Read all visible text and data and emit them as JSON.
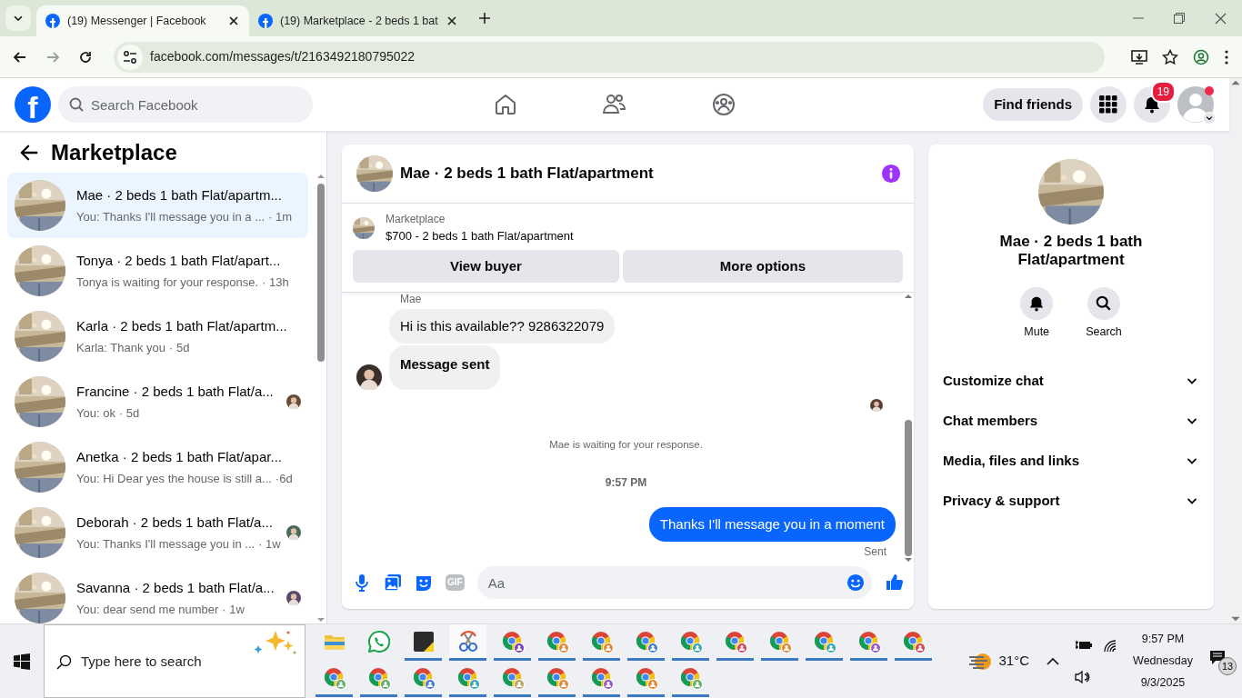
{
  "browser": {
    "tabs": [
      {
        "title": "(19) Messenger | Facebook",
        "selected": true
      },
      {
        "title": "(19) Marketplace - 2 beds 1 bat",
        "selected": false
      }
    ],
    "address": "facebook.com/messages/t/2163492180795022"
  },
  "facebook": {
    "logo": "f",
    "search_placeholder": "Search Facebook",
    "find_friends": "Find friends",
    "notification_count": "19",
    "profile_dot": true
  },
  "sidebar": {
    "title": "Marketplace",
    "conversations": [
      {
        "name": "Mae · 2 beds 1 bath Flat/apartm...",
        "preview": "You: Thanks I'll message you in a ...",
        "time": "· 1m",
        "selected": true,
        "seen": false
      },
      {
        "name": "Tonya · 2 beds 1 bath Flat/apart...",
        "preview": "Tonya is waiting for your response.",
        "time": "· 13h",
        "selected": false,
        "seen": false
      },
      {
        "name": "Karla · 2 beds 1 bath Flat/apartm...",
        "preview": "Karla: Thank you",
        "time": "· 5d",
        "selected": false,
        "seen": false
      },
      {
        "name": "Francine · 2 beds 1 bath Flat/a...",
        "preview": "You: ok",
        "time": "· 5d",
        "selected": false,
        "seen": true
      },
      {
        "name": "Anetka · 2 beds 1 bath Flat/apar...",
        "preview": "You: Hi Dear yes the house is still a...",
        "time": "·6d",
        "selected": false,
        "seen": false
      },
      {
        "name": "Deborah · 2 beds 1 bath Flat/a...",
        "preview": "You: Thanks I'll message you in ...",
        "time": "· 1w",
        "selected": false,
        "seen": true
      },
      {
        "name": "Savanna · 2 beds 1 bath Flat/a...",
        "preview": "You: dear send me number",
        "time": "· 1w",
        "selected": false,
        "seen": true
      }
    ]
  },
  "chat": {
    "title": "Mae · 2 beds 1 bath Flat/apartment",
    "listing_source": "Marketplace",
    "listing": "$700 - 2 beds 1 bath Flat/apartment",
    "actions": [
      "View buyer",
      "More options"
    ],
    "messages": [
      {
        "kind": "sender",
        "text": "Mae"
      },
      {
        "kind": "incoming",
        "text": "Hi is this available?? 9286322079",
        "bold": false,
        "avatar": false
      },
      {
        "kind": "incoming",
        "text": "Message sent",
        "bold": true,
        "avatar": true
      },
      {
        "kind": "read_receipt"
      },
      {
        "kind": "notice",
        "text": "Mae is waiting for your response."
      },
      {
        "kind": "timestamp",
        "text": "9:57 PM"
      },
      {
        "kind": "outgoing",
        "text": "Thanks I'll message you in a moment"
      },
      {
        "kind": "status",
        "text": "Sent"
      }
    ],
    "gif_label": "GIF",
    "composer_placeholder": "Aa"
  },
  "details": {
    "title": "Mae · 2 beds 1 bath Flat/apartment",
    "actions": [
      {
        "kind": "mute",
        "label": "Mute"
      },
      {
        "kind": "search",
        "label": "Search"
      }
    ],
    "sections": [
      {
        "label": "Customize chat",
        "expanded": false
      },
      {
        "label": "Chat members",
        "expanded": false
      },
      {
        "label": "Media, files and links",
        "expanded": false
      },
      {
        "label": "Privacy & support",
        "expanded": false
      }
    ]
  },
  "taskbar": {
    "search_placeholder": "Type here to search",
    "apps": [
      {
        "kind": "folder",
        "running": false,
        "selected": false
      },
      {
        "kind": "whatsapp",
        "running": false,
        "selected": false
      },
      {
        "kind": "notes",
        "running": true,
        "selected": false
      },
      {
        "kind": "snipping",
        "running": true,
        "selected": true
      },
      {
        "kind": "browser",
        "running": true,
        "selected": false,
        "color": "#7b3fb0"
      },
      {
        "kind": "browser",
        "running": true,
        "selected": false,
        "color": "#e0883a"
      },
      {
        "kind": "browser",
        "running": true,
        "selected": false,
        "color": "#e0883a"
      },
      {
        "kind": "browser",
        "running": true,
        "selected": false,
        "color": "#4a7fd0"
      },
      {
        "kind": "browser",
        "running": true,
        "selected": false,
        "color": "#3aa6b0"
      },
      {
        "kind": "browser",
        "running": true,
        "selected": false,
        "color": "#d9435a"
      },
      {
        "kind": "browser",
        "running": true,
        "selected": false,
        "color": "#e0883a"
      },
      {
        "kind": "browser",
        "running": true,
        "selected": false,
        "color": "#3aa6b0"
      },
      {
        "kind": "browser",
        "running": true,
        "selected": false,
        "color": "#9b59c6"
      },
      {
        "kind": "browser",
        "running": true,
        "selected": false,
        "color": "#d9435a"
      },
      {
        "kind": "browser",
        "running": true,
        "selected": false,
        "color": "#5fae6a"
      },
      {
        "kind": "browser",
        "running": true,
        "selected": false,
        "color": "#5fae6a"
      },
      {
        "kind": "browser",
        "running": true,
        "selected": false,
        "color": "#4a7fd0"
      },
      {
        "kind": "browser",
        "running": true,
        "selected": false,
        "color": "#3aa6b0"
      },
      {
        "kind": "browser",
        "running": true,
        "selected": false,
        "color": "#b8a46a"
      },
      {
        "kind": "browser",
        "running": true,
        "selected": false,
        "color": "#e0883a"
      },
      {
        "kind": "browser",
        "running": true,
        "selected": false,
        "color": "#9b59c6"
      },
      {
        "kind": "browser",
        "running": true,
        "selected": false,
        "color": "#e0883a"
      },
      {
        "kind": "browser",
        "running": true,
        "selected": false,
        "color": "#5fae6a"
      }
    ],
    "weather": "31°C",
    "time": "9:57 PM",
    "day": "Wednesday",
    "date": "9/3/2025",
    "notification_count": "13"
  }
}
